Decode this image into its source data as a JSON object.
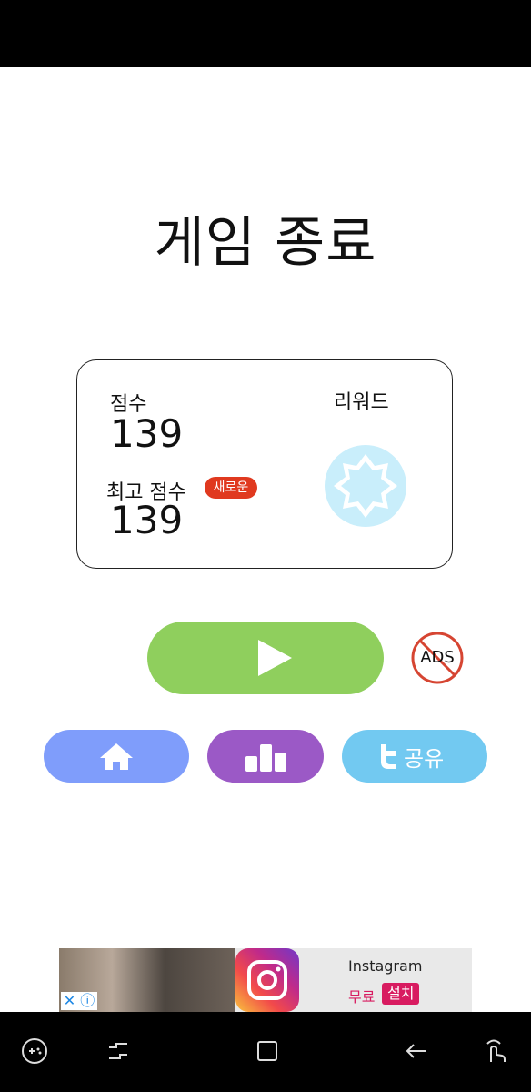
{
  "screen": {
    "title": "게임 종료"
  },
  "score_card": {
    "score_label": "점수",
    "score_value": "139",
    "best_label": "최고 점수",
    "new_badge": "새로운",
    "best_value": "139",
    "reward_label": "리워드"
  },
  "actions": {
    "no_ads_label": "ADS",
    "share_label": "공유"
  },
  "ad_banner": {
    "app_name": "Instagram",
    "free_label": "무료",
    "install_label": "설치",
    "close_glyph": "✕ ⓘ"
  },
  "colors": {
    "play": "#8fcf5d",
    "home": "#7f9dfb",
    "leaderboard": "#9b59c6",
    "share": "#72c9f1",
    "badge": "#e0391f",
    "no_ads": "#d64532",
    "reward_bg": "#c9eefb"
  },
  "icons": [
    "play-icon",
    "no-ads-icon",
    "home-icon",
    "leaderboard-icon",
    "twitter-icon",
    "reward-star-icon",
    "instagram-icon",
    "game-icon",
    "recents-icon",
    "home-nav-icon",
    "back-icon",
    "gesture-icon"
  ]
}
